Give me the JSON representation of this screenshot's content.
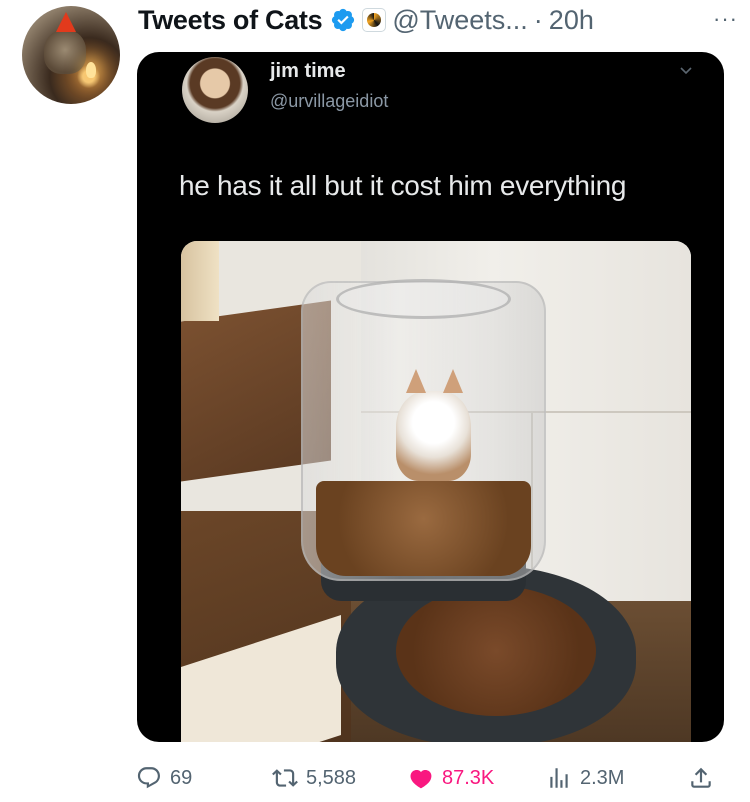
{
  "tweet": {
    "author": {
      "display_name": "Tweets of Cats",
      "handle": "@Tweets...",
      "separator": "·",
      "time": "20h",
      "verified": true
    },
    "more_label": "···",
    "media": {
      "embedded_author": {
        "name": "jim time",
        "handle": "@urvillageidiot"
      },
      "caption": "he has it all but it cost him everything"
    },
    "actions": {
      "replies": "69",
      "retweets": "5,588",
      "likes": "87.3K",
      "views": "2.3M"
    },
    "colors": {
      "verified": "#1d9bf0",
      "like": "#f91880",
      "muted": "#536471"
    }
  }
}
